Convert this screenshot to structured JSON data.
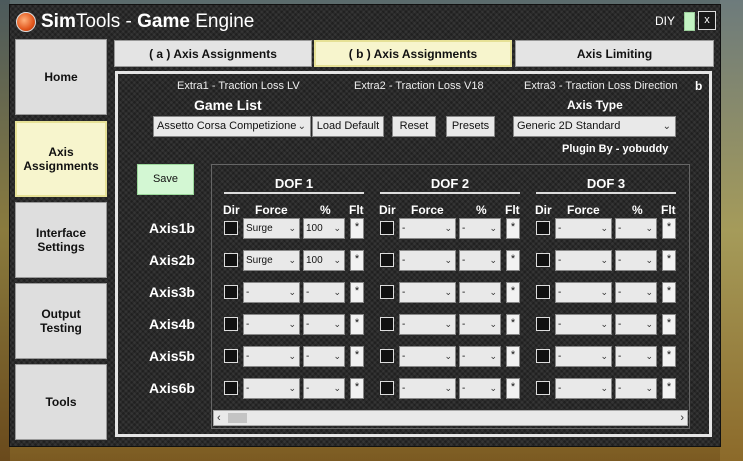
{
  "window": {
    "title_left": "Sim",
    "title_mid": "Tools - ",
    "title_bold": "Game",
    "title_right": " Engine",
    "diy_label": "DIY",
    "close_label": "x"
  },
  "nav": {
    "home": "Home",
    "axis_assignments": "Axis\nAssignments",
    "interface_settings": "Interface\nSettings",
    "output_testing": "Output\nTesting",
    "tools": "Tools"
  },
  "tabs": {
    "a": "( a ) Axis Assignments",
    "b": "( b ) Axis Assignments",
    "limiting": "Axis Limiting"
  },
  "extras": {
    "extra1": "Extra1 - Traction Loss LV",
    "extra2": "Extra2 - Traction Loss V18",
    "extra3": "Extra3 - Traction Loss Direction",
    "b_marker": "b"
  },
  "game": {
    "list_label": "Game List",
    "selected": "Assetto Corsa Competizione",
    "load_default": "Load Default",
    "reset": "Reset",
    "presets": "Presets"
  },
  "axis_type": {
    "label": "Axis Type",
    "selected": "Generic 2D Standard",
    "plugin_by": "Plugin By - yobuddy"
  },
  "save_label": "Save",
  "grid": {
    "dof1": "DOF 1",
    "dof2": "DOF 2",
    "dof3": "DOF 3",
    "col_dir": "Dir",
    "col_force": "Force",
    "col_pct": "%",
    "col_flt": "Flt",
    "flt_mark": "*",
    "rows": [
      {
        "label": "Axis1b",
        "dof1_force": "Surge",
        "dof1_pct": "100",
        "dof2_force": "-",
        "dof2_pct": "-",
        "dof3_force": "-",
        "dof3_pct": "-"
      },
      {
        "label": "Axis2b",
        "dof1_force": "Surge",
        "dof1_pct": "100",
        "dof2_force": "-",
        "dof2_pct": "-",
        "dof3_force": "-",
        "dof3_pct": "-"
      },
      {
        "label": "Axis3b",
        "dof1_force": "-",
        "dof1_pct": "-",
        "dof2_force": "-",
        "dof2_pct": "-",
        "dof3_force": "-",
        "dof3_pct": "-"
      },
      {
        "label": "Axis4b",
        "dof1_force": "-",
        "dof1_pct": "-",
        "dof2_force": "-",
        "dof2_pct": "-",
        "dof3_force": "-",
        "dof3_pct": "-"
      },
      {
        "label": "Axis5b",
        "dof1_force": "-",
        "dof1_pct": "-",
        "dof2_force": "-",
        "dof2_pct": "-",
        "dof3_force": "-",
        "dof3_pct": "-"
      },
      {
        "label": "Axis6b",
        "dof1_force": "-",
        "dof1_pct": "-",
        "dof2_force": "-",
        "dof2_pct": "-",
        "dof3_force": "-",
        "dof3_pct": "-"
      }
    ]
  }
}
